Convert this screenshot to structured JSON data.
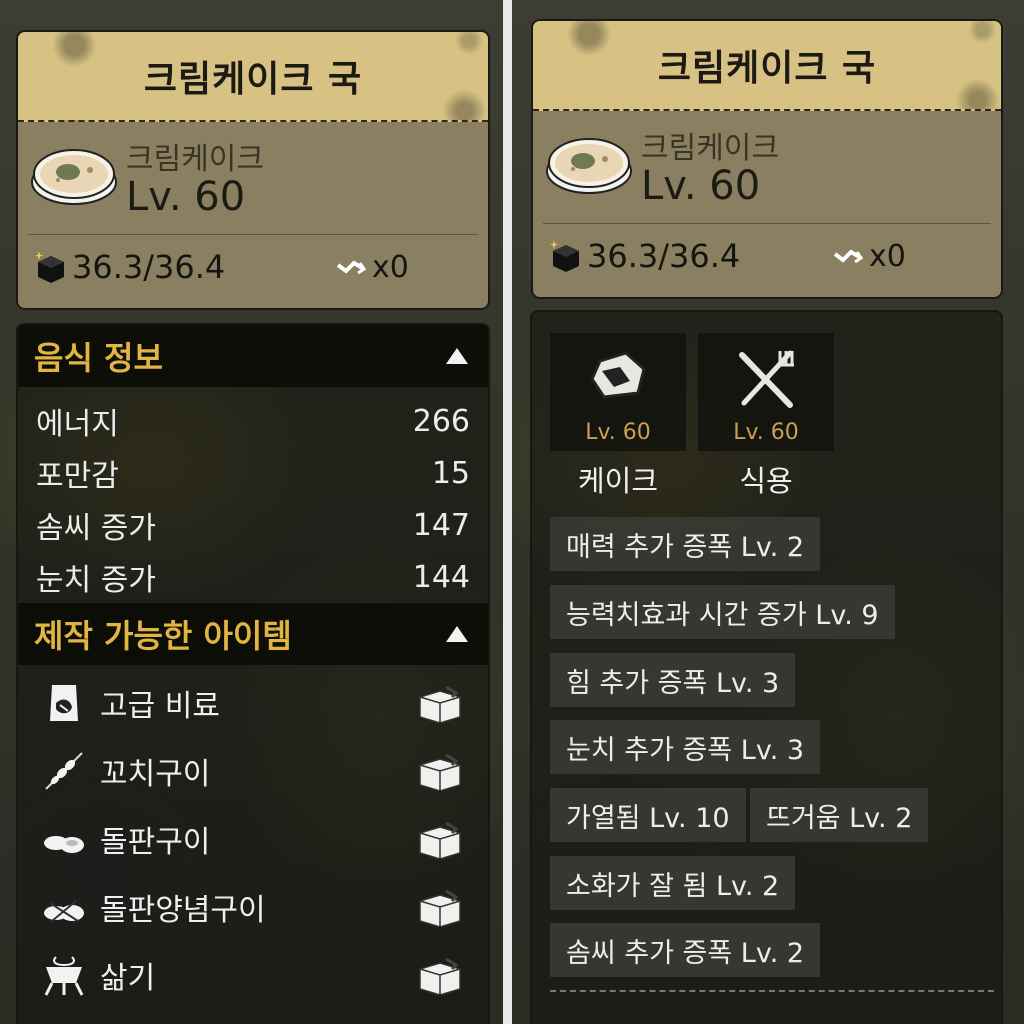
{
  "left": {
    "card": {
      "title": "크림케이크 국",
      "food_name": "크림케이크",
      "level": "Lv. 60",
      "weight": "36.3/36.4",
      "multiplier": "x0"
    },
    "food_info": {
      "header": "음식 정보",
      "stats": [
        {
          "label": "에너지",
          "value": "266"
        },
        {
          "label": "포만감",
          "value": "15"
        },
        {
          "label": "솜씨 증가",
          "value": "147"
        },
        {
          "label": "눈치 증가",
          "value": "144"
        }
      ]
    },
    "craftable": {
      "header": "제작 가능한 아이템",
      "items": [
        {
          "label": "고급 비료",
          "icon": "fertilizer-bag-icon"
        },
        {
          "label": "꼬치구이",
          "icon": "skewer-icon"
        },
        {
          "label": "돌판구이",
          "icon": "stone-grill-icon"
        },
        {
          "label": "돌판양념구이",
          "icon": "seasoned-grill-icon"
        },
        {
          "label": "삶기",
          "icon": "boiling-pot-icon"
        }
      ]
    }
  },
  "right": {
    "card": {
      "title": "크림케이크 국",
      "food_name": "크림케이크",
      "level": "Lv. 60",
      "weight": "36.3/36.4",
      "multiplier": "x0"
    },
    "skills": [
      {
        "name": "케이크",
        "level": "Lv. 60",
        "icon": "cake-icon"
      },
      {
        "name": "식용",
        "level": "Lv. 60",
        "icon": "fork-knife-icon"
      }
    ],
    "tags": [
      "매력 추가 증폭 Lv. 2",
      "능력치효과 시간 증가  Lv. 9",
      "힘 추가 증폭 Lv. 3",
      "눈치 추가 증폭 Lv. 3",
      "가열됨 Lv. 10",
      "뜨거움 Lv. 2",
      "소화가 잘 됨 Lv. 2",
      "솜씨 추가 증폭 Lv. 2"
    ]
  },
  "colors": {
    "header_gold": "#d7c284",
    "section_label": "#e0b541",
    "level_text": "#c99f52"
  }
}
